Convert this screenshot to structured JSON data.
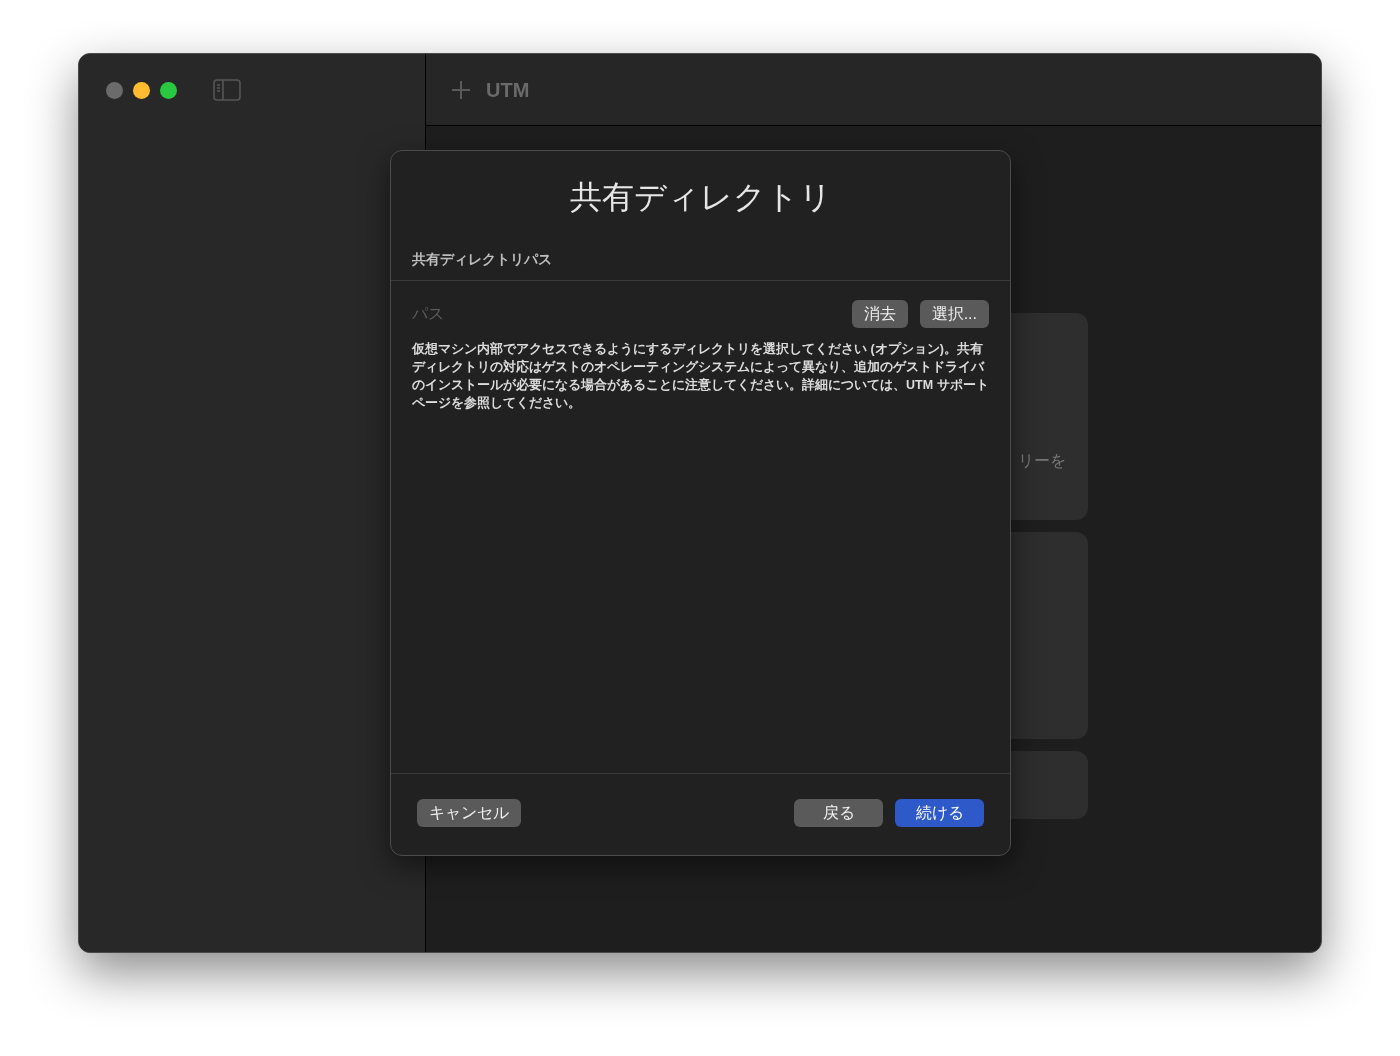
{
  "window": {
    "title": "UTM",
    "controls": [
      {
        "color": "#6b6b6b"
      },
      {
        "color": "#febc2e"
      },
      {
        "color": "#28c840"
      }
    ]
  },
  "background_cards": [
    {
      "kind": "tall",
      "text": "リーを"
    },
    {
      "kind": "tall"
    },
    {
      "kind": "short"
    }
  ],
  "dialog": {
    "title": "共有ディレクトリ",
    "section": "共有ディレクトリパス",
    "path_label": "パス",
    "path_buttons": [
      "消去",
      "選択..."
    ],
    "description": "仮想マシン内部でアクセスできるようにするディレクトリを選択してください (オプション)。共有ディレクトリの対応はゲストのオペレーティングシステムによって異なり、追加のゲストドライバのインストールが必要になる場合があることに注意してください。詳細については、UTM サポートページを参照してください。",
    "cancel": "キャンセル",
    "back": "戻る",
    "continue": "続ける"
  }
}
